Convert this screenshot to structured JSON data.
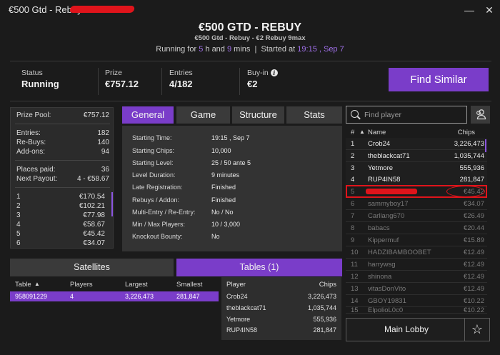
{
  "window": {
    "title": "€500 Gtd - Rebuy",
    "minimize": "—",
    "close": "✕"
  },
  "header": {
    "title": "€500 GTD - REBUY",
    "subtitle": "€500 Gtd - Rebuy - €2 Rebuy 9max",
    "running_prefix": "Running for",
    "running_h": "5",
    "h_label": "h and",
    "running_m": "9",
    "m_label": "mins",
    "separator": "|",
    "started_label": "Started at",
    "started_value": "19:15 , Sep 7"
  },
  "stats": {
    "status_label": "Status",
    "status_value": "Running",
    "prize_label": "Prize",
    "prize_value": "€757.12",
    "entries_label": "Entries",
    "entries_value": "4/182",
    "buyin_label": "Buy-in",
    "buyin_value": "€2",
    "find_similar": "Find Similar"
  },
  "left_panel": {
    "prize_pool_label": "Prize Pool:",
    "prize_pool": "€757.12",
    "entries_label": "Entries:",
    "entries": "182",
    "rebuys_label": "Re-Buys:",
    "rebuys": "140",
    "addons_label": "Add-ons:",
    "addons": "94",
    "places_paid_label": "Places paid:",
    "places_paid": "36",
    "next_payout_label": "Next Payout:",
    "next_payout": "4 - €58.67",
    "payouts": [
      {
        "place": "1",
        "amount": "€170.54"
      },
      {
        "place": "2",
        "amount": "€102.21"
      },
      {
        "place": "3",
        "amount": "€77.98"
      },
      {
        "place": "4",
        "amount": "€58.67"
      },
      {
        "place": "5",
        "amount": "€45.42"
      },
      {
        "place": "6",
        "amount": "€34.07"
      }
    ]
  },
  "tabs": [
    "General",
    "Game",
    "Structure",
    "Stats"
  ],
  "general": [
    {
      "label": "Starting Time:",
      "value": "19:15 , Sep 7"
    },
    {
      "label": "Starting Chips:",
      "value": "10,000"
    },
    {
      "label": "Starting Level:",
      "value": "25 / 50 ante 5"
    },
    {
      "label": "Level Duration:",
      "value": "9 minutes"
    },
    {
      "label": "Late Registration:",
      "value": "Finished"
    },
    {
      "label": "Rebuys / Addon:",
      "value": "Finished"
    },
    {
      "label": "Multi-Entry / Re-Entry:",
      "value": "No / No"
    },
    {
      "label": "Min / Max Players:",
      "value": "10 / 3,000"
    },
    {
      "label": "Knockout Bounty:",
      "value": "No"
    }
  ],
  "bottom_tabs": {
    "satellites": "Satellites",
    "tables": "Tables (1)"
  },
  "tables": {
    "headers": [
      "Table",
      "▲",
      "Players",
      "Largest",
      "Smallest"
    ],
    "rows": [
      {
        "table": "958091229",
        "players": "4",
        "largest": "3,226,473",
        "smallest": "281,847"
      }
    ]
  },
  "table_players": {
    "header_player": "Player",
    "header_chips": "Chips",
    "rows": [
      {
        "player": "Crob24",
        "chips": "3,226,473"
      },
      {
        "player": "theblackcat71",
        "chips": "1,035,744"
      },
      {
        "player": "Yetmore",
        "chips": "555,936"
      },
      {
        "player": "RUP4IN58",
        "chips": "281,847"
      }
    ]
  },
  "rankings": {
    "search_placeholder": "Find player",
    "header_rank": "#",
    "header_sort": "▲",
    "header_name": "Name",
    "header_chips": "Chips",
    "rows": [
      {
        "rank": "1",
        "name": "Crob24",
        "chips": "3,226,473"
      },
      {
        "rank": "2",
        "name": "theblackcat71",
        "chips": "1,035,744"
      },
      {
        "rank": "3",
        "name": "Yetmore",
        "chips": "555,936"
      },
      {
        "rank": "4",
        "name": "RUP4IN58",
        "chips": "281,847"
      },
      {
        "rank": "5",
        "name": "",
        "chips": "€45.42"
      },
      {
        "rank": "6",
        "name": "sammyboy17",
        "chips": "€34.07"
      },
      {
        "rank": "7",
        "name": "Carllang670",
        "chips": "€26.49"
      },
      {
        "rank": "8",
        "name": "babacs",
        "chips": "€20.44"
      },
      {
        "rank": "9",
        "name": "Kippermuf",
        "chips": "€15.89"
      },
      {
        "rank": "10",
        "name": "HADZIBAMBOOBET",
        "chips": "€12.49"
      },
      {
        "rank": "11",
        "name": "harrywsg",
        "chips": "€12.49"
      },
      {
        "rank": "12",
        "name": "shinona",
        "chips": "€12.49"
      },
      {
        "rank": "13",
        "name": "vitasDonVito",
        "chips": "€12.49"
      },
      {
        "rank": "14",
        "name": "GBOY19831",
        "chips": "€10.22"
      },
      {
        "rank": "15",
        "name": "ElpolioL0c0",
        "chips": "€10.22"
      }
    ],
    "main_lobby": "Main Lobby",
    "star": "☆"
  },
  "colors": {
    "accent": "#7a3dc9",
    "highlight": "#e0141b",
    "background": "#1b1b1b"
  }
}
